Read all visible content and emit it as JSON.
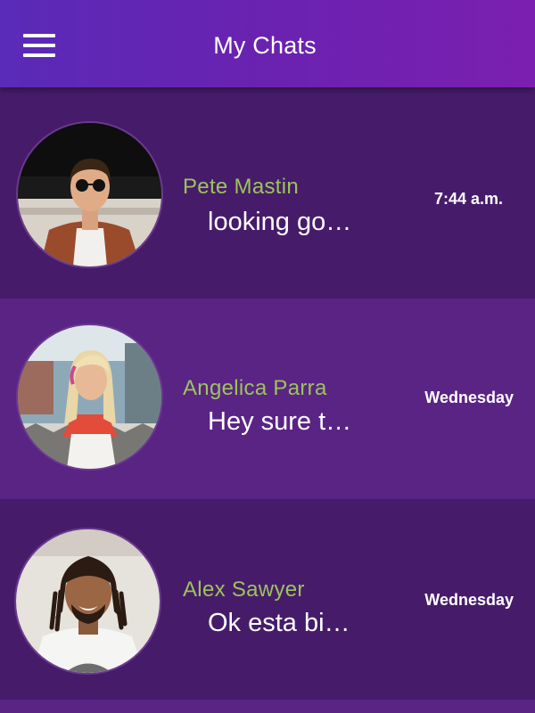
{
  "header": {
    "title": "My Chats",
    "menu_icon": "hamburger-menu-icon"
  },
  "chats": [
    {
      "name": "Pete Mastin",
      "preview": "looking go…",
      "time": "7:44 a.m."
    },
    {
      "name": "Angelica Parra",
      "preview": "Hey sure t…",
      "time": "Wednesday"
    },
    {
      "name": "Alex Sawyer",
      "preview": "Ok esta bi…",
      "time": "Wednesday"
    }
  ],
  "colors": {
    "header_gradient_start": "#5a2ab8",
    "header_gradient_end": "#7b1fb0",
    "row_dark": "#461c6a",
    "row_light": "#5a2485",
    "name_green": "#9cc45a",
    "text_white": "#ffffff"
  }
}
